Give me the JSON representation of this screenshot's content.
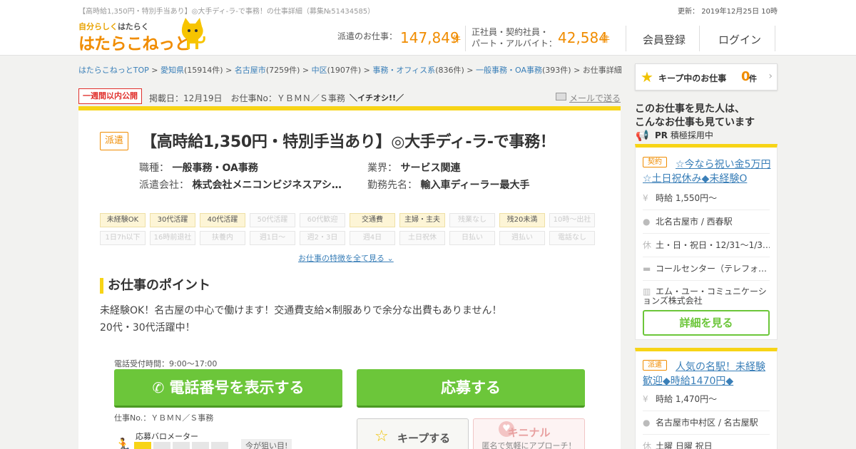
{
  "header": {
    "seo_text": "【高時給1,350円・特別手当あり】◎大手ディ-ラ-で事務！の仕事詳細（募集№51434585）",
    "updated": "更新： 2019年12月25日 10時",
    "logo_small_a": "自分らしく",
    "logo_small_b": "はたらく",
    "logo_main": "はたらこねっと",
    "haken_label": "派遣のお仕事：",
    "haken_count": "147,849",
    "unit": "件",
    "seishain_label_1": "正社員・契約社員・",
    "seishain_label_2": "パート・アルバイト：",
    "seishain_count": "42,584",
    "register": "会員登録",
    "login": "ログイン"
  },
  "breadcrumb": [
    {
      "label": "はたらこねっとTOP",
      "count": ""
    },
    {
      "label": "愛知県",
      "count": "(15914件)"
    },
    {
      "label": "名古屋市",
      "count": "(7259件)"
    },
    {
      "label": "中区",
      "count": "(1907件)"
    },
    {
      "label": "事務・オフィス系",
      "count": "(836件)"
    },
    {
      "label": "一般事務・OA事務",
      "count": "(393件)"
    },
    {
      "label": "お仕事詳細",
      "count": ""
    }
  ],
  "job": {
    "new_badge": "一週間以内公開",
    "posted": "掲載日：12月19日　お仕事No：ＹＢＭＮ／Ｓ事務",
    "recommend": "＼イチオシ!!／",
    "mail_link": "メールで送る",
    "type": "派遣",
    "title": "【高時給1,350円・特別手当あり】◎大手ディ-ラ-で事務！",
    "occupation_label": "職種：",
    "occupation": "一般事務・OA事務",
    "industry_label": "業界：",
    "industry": "サービス関連",
    "agency_label": "派遣会社：",
    "agency": "株式会社メニコンビジネスアシ…",
    "workplace_label": "勤務先名：",
    "workplace": "輸入車ディーラー最大手",
    "tags": [
      {
        "label": "未経験OK",
        "on": true
      },
      {
        "label": "30代活躍",
        "on": true
      },
      {
        "label": "40代活躍",
        "on": true
      },
      {
        "label": "50代活躍",
        "on": false
      },
      {
        "label": "60代歓迎",
        "on": false
      },
      {
        "label": "交通費",
        "on": true
      },
      {
        "label": "主婦・主夫",
        "on": true
      },
      {
        "label": "残業なし",
        "on": false
      },
      {
        "label": "残20未満",
        "on": true
      },
      {
        "label": "10時～出社",
        "on": false
      },
      {
        "label": "1日7h以下",
        "on": false
      },
      {
        "label": "16時前退社",
        "on": false
      },
      {
        "label": "扶養内",
        "on": false
      },
      {
        "label": "週1日～",
        "on": false
      },
      {
        "label": "週2・3日",
        "on": false
      },
      {
        "label": "週4日",
        "on": false
      },
      {
        "label": "土日祝休",
        "on": false
      },
      {
        "label": "日払い",
        "on": false
      },
      {
        "label": "週払い",
        "on": false
      },
      {
        "label": "電話なし",
        "on": false
      }
    ],
    "more_features": "お仕事の特徴を全て見る",
    "point_heading": "お仕事のポイント",
    "point_line1": "未経験OK！名古屋の中心で働けます！交通費支給×制服ありで余分な出費もありません！",
    "point_line2": "20代・30代活躍中！",
    "phone_hours": "電話受付時間：9:00～17:00",
    "phone_button": "電話番号を表示する",
    "apply_button": "応募する",
    "job_no": "仕事No.：ＹＢＭＮ／Ｓ事務",
    "meter_label": "応募バロメーター",
    "meter_level": 1,
    "meter_max": 5,
    "meter_bubble": "今が狙い目!",
    "keep_button": "キープする",
    "kinenal_title": "キニナル",
    "kinenal_sub": "匿名で気軽にアプローチ！"
  },
  "sidebar": {
    "keep_label": "キープ中のお仕事",
    "keep_count": "0",
    "keep_unit": "件",
    "heading_1": "このお仕事を見た人は、",
    "heading_2": "こんなお仕事も見ています",
    "pr_label": "PR",
    "pr_text": "積極採用中",
    "cards": [
      {
        "type": "契約",
        "title": "☆今なら祝い金5万円☆土日祝休み◆未経験O",
        "wage": "時給 1,550円～",
        "location": "北名古屋市 / 西春駅",
        "holiday": "土・日・祝日・12/31～1/3…",
        "job": "コールセンター（テレフォ…",
        "company": "エム・ユー・コミュニケーションズ株式会社",
        "button": "詳細を見る"
      },
      {
        "type": "派遣",
        "title": "人気の名駅！未経験歓迎◆時給1470円◆",
        "wage": "時給 1,470円～",
        "location": "名古屋市中村区 / 名古屋駅",
        "holiday": "土曜 日曜 祝日"
      }
    ]
  }
}
